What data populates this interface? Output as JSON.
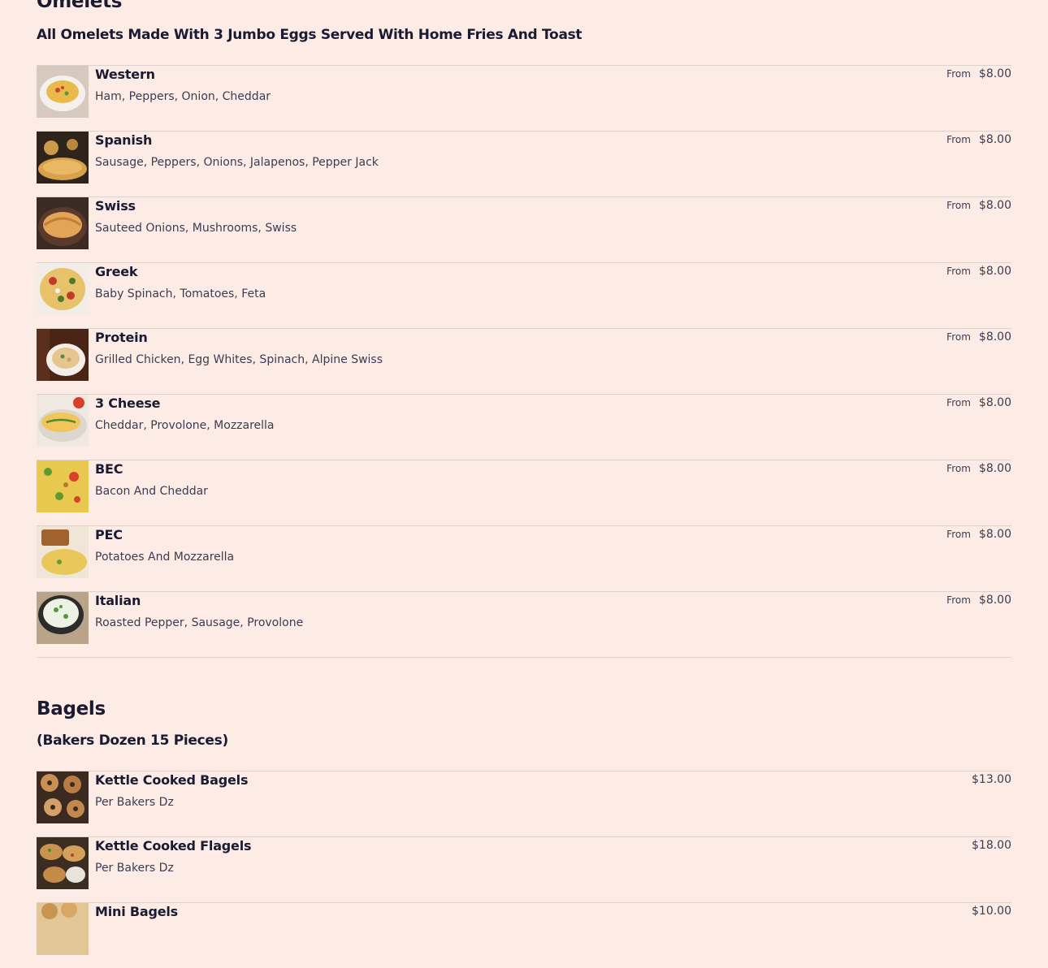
{
  "sections": [
    {
      "title": "Omelets",
      "subtitle": "All Omelets Made With 3 Jumbo Eggs Served With Home Fries And Toast",
      "items": [
        {
          "name": "Western",
          "description": "Ham, Peppers, Onion, Cheddar",
          "price_prefix": "From",
          "price": "$8.00",
          "image": "western-omelet"
        },
        {
          "name": "Spanish",
          "description": "Sausage, Peppers, Onions, Jalapenos, Pepper Jack",
          "price_prefix": "From",
          "price": "$8.00",
          "image": "spanish-omelet"
        },
        {
          "name": "Swiss",
          "description": "Sauteed Onions, Mushrooms, Swiss",
          "price_prefix": "From",
          "price": "$8.00",
          "image": "swiss-omelet"
        },
        {
          "name": "Greek",
          "description": "Baby Spinach, Tomatoes, Feta",
          "price_prefix": "From",
          "price": "$8.00",
          "image": "greek-omelet"
        },
        {
          "name": "Protein",
          "description": "Grilled Chicken, Egg Whites, Spinach, Alpine Swiss",
          "price_prefix": "From",
          "price": "$8.00",
          "image": "protein-omelet"
        },
        {
          "name": "3 Cheese",
          "description": "Cheddar, Provolone, Mozzarella",
          "price_prefix": "From",
          "price": "$8.00",
          "image": "3-cheese-omelet"
        },
        {
          "name": "BEC",
          "description": "Bacon And Cheddar",
          "price_prefix": "From",
          "price": "$8.00",
          "image": "bec-omelet"
        },
        {
          "name": "PEC",
          "description": "Potatoes And Mozzarella",
          "price_prefix": "From",
          "price": "$8.00",
          "image": "pec-omelet"
        },
        {
          "name": "Italian",
          "description": "Roasted Pepper, Sausage, Provolone",
          "price_prefix": "From",
          "price": "$8.00",
          "image": "italian-omelet"
        }
      ]
    },
    {
      "title": "Bagels",
      "subtitle": "(Bakers Dozen 15 Pieces)",
      "items": [
        {
          "name": "Kettle Cooked Bagels",
          "description": "Per Bakers Dz",
          "price": "$13.00",
          "image": "bagels"
        },
        {
          "name": "Kettle Cooked Flagels",
          "description": "Per Bakers Dz",
          "price": "$18.00",
          "image": "flagels"
        },
        {
          "name": "Mini Bagels",
          "description": "",
          "price": "$10.00",
          "image": "mini-bagels"
        }
      ]
    }
  ],
  "colors": {
    "background": "#fdece5",
    "text_primary": "#1a1b33",
    "text_secondary": "#3b3c52",
    "divider": "#dcd3cf"
  }
}
